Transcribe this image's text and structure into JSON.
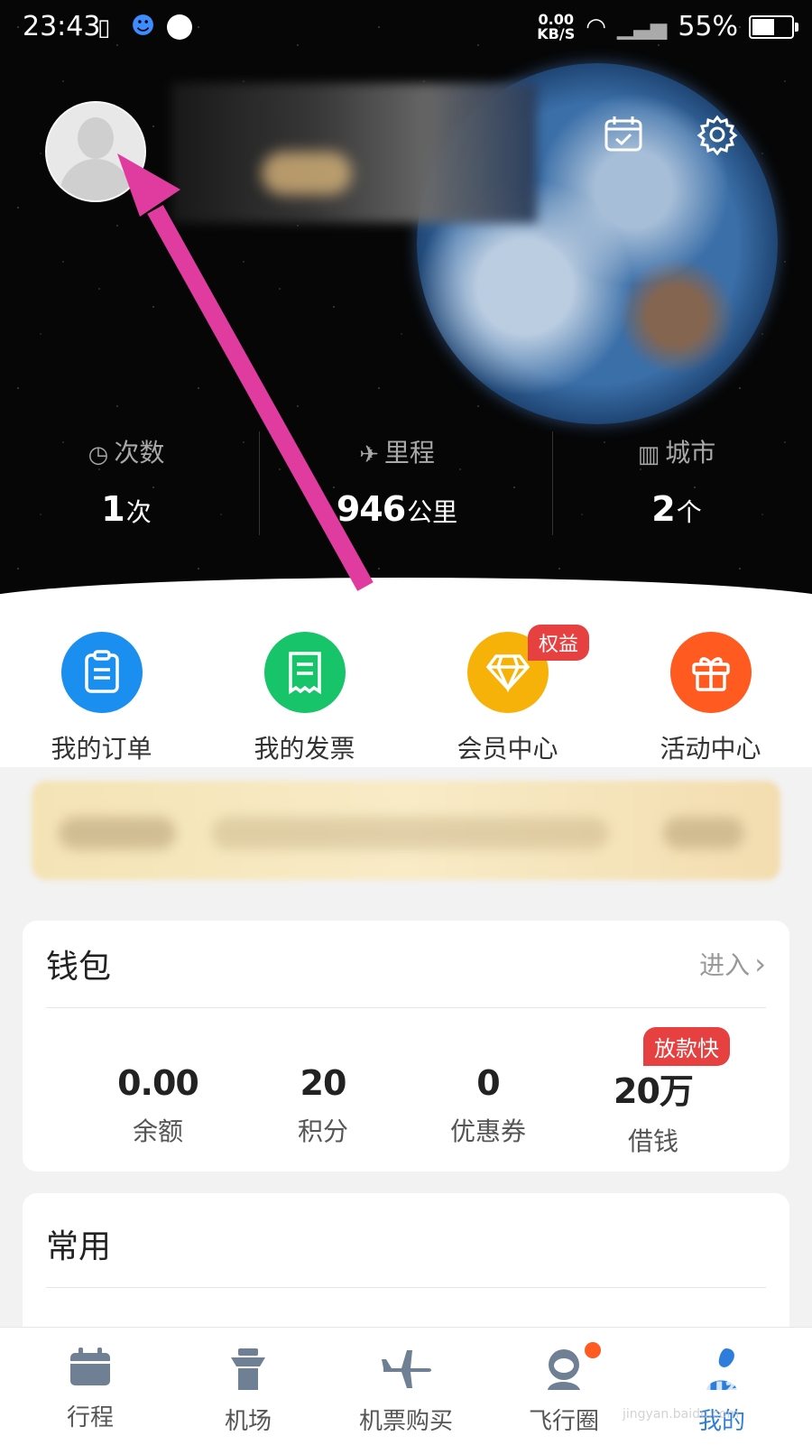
{
  "status_bar": {
    "time": "23:43",
    "net_speed_value": "0.00",
    "net_speed_unit": "KB/S",
    "battery": "55%"
  },
  "stats": [
    {
      "icon": "clock-icon",
      "label": "次数",
      "value": "1",
      "unit": "次"
    },
    {
      "icon": "plane-icon",
      "label": "里程",
      "value": "946",
      "unit": "公里"
    },
    {
      "icon": "building-icon",
      "label": "城市",
      "value": "2",
      "unit": "个"
    }
  ],
  "quick_actions": [
    {
      "label": "我的订单",
      "color": "#1a8ff0",
      "icon": "clipboard-icon"
    },
    {
      "label": "我的发票",
      "color": "#17c46a",
      "icon": "receipt-icon"
    },
    {
      "label": "会员中心",
      "color": "#f7b20a",
      "icon": "diamond-icon",
      "badge": "权益"
    },
    {
      "label": "活动中心",
      "color": "#ff5a1f",
      "icon": "gift-icon"
    }
  ],
  "wallet": {
    "title": "钱包",
    "enter_label": "进入",
    "items": [
      {
        "value": "0.00",
        "label": "余额"
      },
      {
        "value": "20",
        "label": "积分"
      },
      {
        "value": "0",
        "label": "优惠券"
      },
      {
        "value": "20万",
        "label": "借钱",
        "badge": "放款快"
      }
    ]
  },
  "common": {
    "title": "常用"
  },
  "tabs": [
    {
      "label": "行程",
      "icon": "calendar-icon"
    },
    {
      "label": "机场",
      "icon": "tower-icon"
    },
    {
      "label": "机票购买",
      "icon": "airplane-icon"
    },
    {
      "label": "飞行圈",
      "icon": "astronaut-icon"
    },
    {
      "label": "我的",
      "icon": "profile-icon"
    }
  ],
  "colors": {
    "active_tab": "#2d7ddc",
    "badge": "#e64040",
    "annotation_arrow": "#e03ca0"
  }
}
